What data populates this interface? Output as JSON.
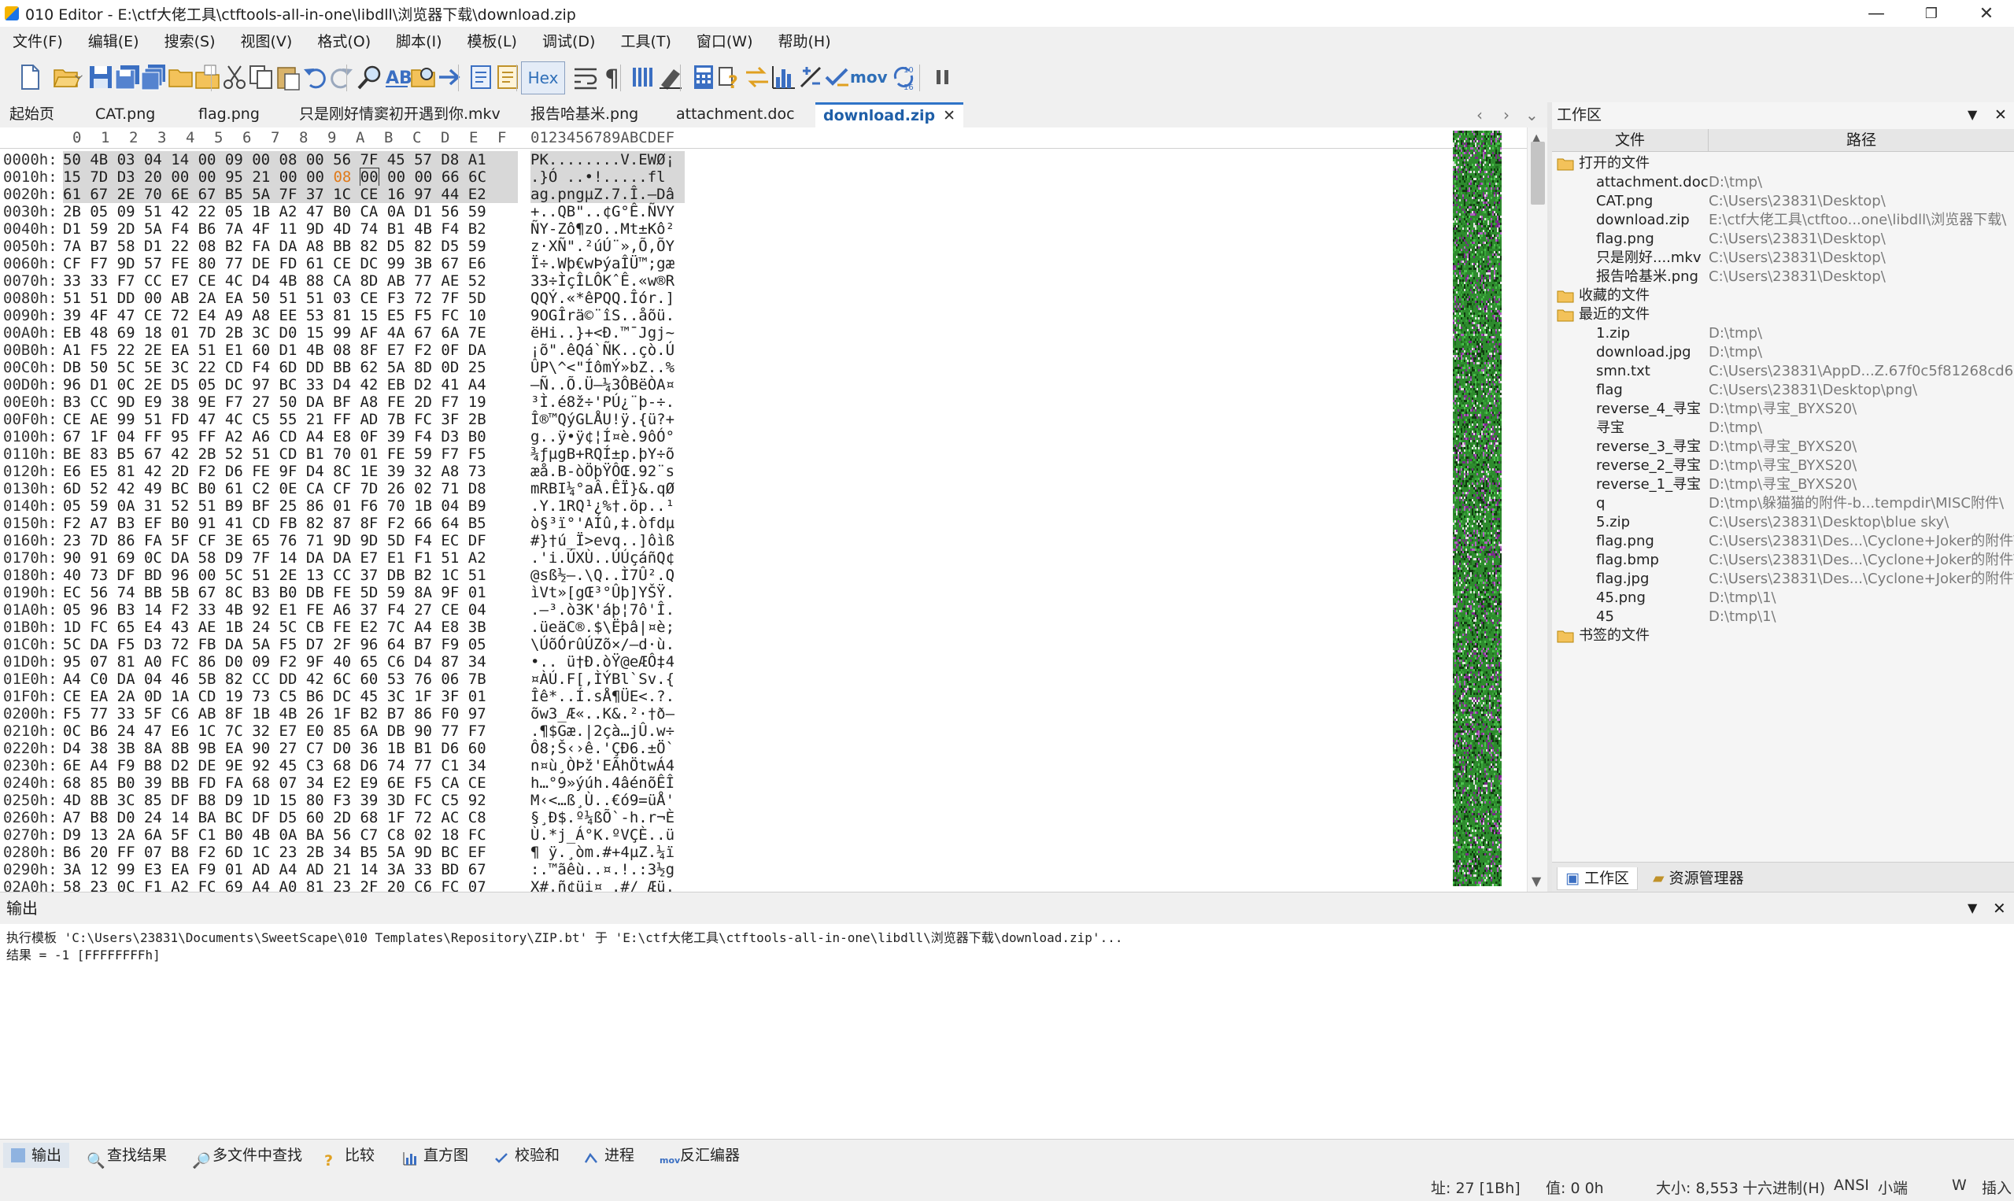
{
  "window": {
    "title": "010 Editor - E:\\ctf大佬工具\\ctftools-all-in-one\\libdll\\浏览器下载\\download.zip",
    "minimize": "—",
    "maximize": "❐",
    "close": "✕"
  },
  "menu": [
    "文件(F)",
    "编辑(E)",
    "搜索(S)",
    "视图(V)",
    "格式(O)",
    "脚本(I)",
    "模板(L)",
    "调试(D)",
    "工具(T)",
    "窗口(W)",
    "帮助(H)"
  ],
  "toolbar": {
    "hex_label": "Hex",
    "mov_label": "mov"
  },
  "tabs": [
    "起始页",
    "CAT.png",
    "flag.png",
    "只是刚好情窦初开遇到你.mkv",
    "报告哈基米.png",
    "attachment.doc",
    "download.zip"
  ],
  "tab_close": "✕",
  "hex": {
    "header_cols": [
      "0",
      "1",
      "2",
      "3",
      "4",
      "5",
      "6",
      "7",
      "8",
      "9",
      "A",
      "B",
      "C",
      "D",
      "E",
      "F"
    ],
    "header_chars": "0123456789ABCDEF",
    "rows": [
      [
        "0000h:",
        "50 4B 03 04 14 00 09 00 08 00 56 7F 45 57 D8 A1",
        "PK........V.EWØ¡"
      ],
      [
        "0010h:",
        "15 7D D3 20 00 00 95 21 00 00 08 00 00 00 66 6C",
        ".}Ó ..•!.....fl"
      ],
      [
        "0020h:",
        "61 67 2E 70 6E 67 B5 5A 7F 37 1C CE 16 97 44 E2",
        "ag.pngµZ.7.Î.—Dâ"
      ],
      [
        "0030h:",
        "2B 05 09 51 42 22 05 1B A2 47 B0 CA 0A D1 56 59",
        "+..QB\"..¢G°Ê.ÑVY"
      ],
      [
        "0040h:",
        "D1 59 2D 5A F4 B6 7A 4F 11 9D 4D 74 B1 4B F4 B2",
        "ÑY-Zô¶zO..Mt±Kô²"
      ],
      [
        "0050h:",
        "7A B7 58 D1 22 08 B2 FA DA A8 BB 82 D5 82 D5 59",
        "z·XÑ\".²úÚ¨»‚Õ‚ÕY"
      ],
      [
        "0060h:",
        "CF F7 9D 57 FE 80 77 DE FD 61 CE DC 99 3B 67 E6",
        "Ï÷.Wþ€wÞýaÎÜ™;gæ"
      ],
      [
        "0070h:",
        "33 33 F7 CC E7 CE 4C D4 4B 88 CA 8D AB 77 AE 52",
        "33÷ÌçÎLÔKˆÊ.«w®R"
      ],
      [
        "0080h:",
        "51 51 DD 00 AB 2A EA 50 51 51 03 CE F3 72 7F 5D",
        "QQÝ.«*êPQQ.Îór.]"
      ],
      [
        "0090h:",
        "39 4F 47 CE 72 E4 A9 A8 EE 53 81 15 E5 F5 FC 10",
        "9OGÎrä©¨îS..åõü."
      ],
      [
        "00A0h:",
        "EB 48 69 18 01 7D 2B 3C D0 15 99 AF 4A 67 6A 7E",
        "ëHi..}+<Ð.™¯Jgj~"
      ],
      [
        "00B0h:",
        "A1 F5 22 2E EA 51 E1 60 D1 4B 08 8F E7 F2 0F DA",
        "¡õ\".êQá`ÑK..çò.Ú"
      ],
      [
        "00C0h:",
        "DB 50 5C 5E 3C 22 CD F4 6D DD BB 62 5A 8D 0D 25",
        "ÛP\\^<\"ÍômÝ»bZ..%"
      ],
      [
        "00D0h:",
        "96 D1 0C 2E D5 05 DC 97 BC 33 D4 42 EB D2 41 A4",
        "–Ñ..Õ.Ü—¼3ÔBëÒA¤"
      ],
      [
        "00E0h:",
        "B3 CC 9D E9 38 9E F7 27 50 DA BF A8 FE 2D F7 19",
        "³Ì.é8ž÷'PÚ¿¨þ-÷."
      ],
      [
        "00F0h:",
        "CE AE 99 51 FD 47 4C C5 55 21 FF AD 7B FC 3F 2B",
        "Î®™QýGLÅU!ÿ.{ü?+"
      ],
      [
        "0100h:",
        "67 1F 04 FF 95 FF A2 A6 CD A4 E8 0F 39 F4 D3 B0",
        "g..ÿ•ÿ¢¦Í¤è.9ôÓ°"
      ],
      [
        "0110h:",
        "BE 83 B5 67 42 2B 52 51 CD B1 70 01 FE 59 F7 F5",
        "¾ƒµgB+RQÍ±p.þY÷õ"
      ],
      [
        "0120h:",
        "E6 E5 81 42 2D F2 D6 FE 9F D4 8C 1E 39 32 A8 73",
        "æå.B-òÖþŸÔŒ.92¨s"
      ],
      [
        "0130h:",
        "6D 52 42 49 BC B0 61 C2 0E CA CF 7D 26 02 71 D8",
        "mRBI¼°aÂ.ÊÏ}&.qØ"
      ],
      [
        "0140h:",
        "05 59 0A 31 52 51 B9 BF 25 86 01 F6 70 1B 04 B9",
        ".Y.1RQ¹¿%†.öp..¹"
      ],
      [
        "0150h:",
        "F2 A7 B3 EF B0 91 41 CD FB 82 87 8F F2 66 64 B5",
        "ò§³ï°'AÍû‚‡.òfdµ"
      ],
      [
        "0160h:",
        "23 7D 86 FA 5F CF 3E 65 76 71 9D 9D 5D F4 EC DF",
        "#}†ú_Ï>evq..]ôìß"
      ],
      [
        "0170h:",
        "90 91 69 0C DA 58 D9 7F 14 DA DA E7 E1 F1 51 A2",
        ".'i.ÚXÙ..ÚÚçáñQ¢"
      ],
      [
        "0180h:",
        "40 73 DF BD 96 00 5C 51 2E 13 CC 37 DB B2 1C 51",
        "@sß½–.\\Q..Ì7Û².Q"
      ],
      [
        "0190h:",
        "EC 56 74 BB 5B 67 8C B3 B0 DB FE 5D 59 8A 9F 01",
        "ìVt»[gŒ³°Ûþ]YŠŸ."
      ],
      [
        "01A0h:",
        "05 96 B3 14 F2 33 4B 92 E1 FE A6 37 F4 27 CE 04",
        ".–³.ò3K'áþ¦7ô'Î."
      ],
      [
        "01B0h:",
        "1D FC 65 E4 43 AE 1B 24 5C CB FE E2 7C A4 E8 3B",
        ".üeäC®.$\\Ëþâ|¤è;"
      ],
      [
        "01C0h:",
        "5C DA F5 D3 72 FB DA 5A F5 D7 2F 96 64 B7 F9 05",
        "\\ÚõÓrûÚZõ×/–d·ù."
      ],
      [
        "01D0h:",
        "95 07 81 A0 FC 86 D0 09 F2 9F 40 65 C6 D4 87 34",
        "•.. ü†Ð.òŸ@eÆÔ‡4"
      ],
      [
        "01E0h:",
        "A4 C0 DA 04 46 5B 82 CC DD 42 6C 60 53 76 06 7B",
        "¤ÀÚ.F[‚ÌÝBl`Sv.{"
      ],
      [
        "01F0h:",
        "CE EA 2A 0D 1A CD 19 73 C5 B6 DC 45 3C 1F 3F 01",
        "Îê*..Í.sÅ¶ÜE<.?."
      ],
      [
        "0200h:",
        "F5 77 33 5F C6 AB 8F 1B 4B 26 1F B2 B7 86 F0 97",
        "õw3_Æ«..K&.²·†ð—"
      ],
      [
        "0210h:",
        "0C B6 24 47 E6 1C 7C 32 E7 E0 85 6A DB 90 77 F7",
        ".¶$Gæ.|2çà…jÛ.w÷"
      ],
      [
        "0220h:",
        "D4 38 3B 8A 8B 9B EA 90 27 C7 D0 36 1B B1 D6 60",
        "Ô8;Š‹›ê.'ÇÐ6.±Ö`"
      ],
      [
        "0230h:",
        "6E A4 F9 B8 D2 DE 9E 92 45 C3 68 D6 74 77 C1 34",
        "n¤ù¸ÒÞž'EÃhÖtwÁ4"
      ],
      [
        "0240h:",
        "68 85 B0 39 BB FD FA 68 07 34 E2 E9 6E F5 CA CE",
        "h…°9»ýúh.4âénõÊÎ"
      ],
      [
        "0250h:",
        "4D 8B 3C 85 DF B8 D9 1D 15 80 F3 39 3D FC C5 92",
        "M‹<…ß¸Ù..€ó9=üÅ'"
      ],
      [
        "0260h:",
        "A7 B8 D0 24 14 BA BC DF D5 60 2D 68 1F 72 AC C8",
        "§¸Ð$.º¼ßÕ`-h.r¬È"
      ],
      [
        "0270h:",
        "D9 13 2A 6A 5F C1 B0 4B 0A BA 56 C7 C8 02 18 FC",
        "Ù.*j_Á°K.ºVÇÈ..ü"
      ],
      [
        "0280h:",
        "B6 20 FF 07 B8 F2 6D 1C 23 2B 34 B5 5A 9D BC EF",
        "¶ ÿ.¸òm.#+4µZ.¼ï"
      ],
      [
        "0290h:",
        "3A 12 99 E3 EA F9 01 AD A4 AD 21 14 3A 33 BD 67",
        ":.™ãêù..¤.!.:3½g"
      ],
      [
        "02A0h:",
        "58 23 0C F1 A2 FC 69 A4 A0 81 23 2F 20 C6 FC 07",
        "X#.ñ¢üi¤ .#/ Æü."
      ]
    ]
  },
  "workspace": {
    "title": "工作区",
    "col_file": "文件",
    "col_path": "路径",
    "groups": [
      {
        "name": "打开的文件",
        "items": [
          [
            "attachment.doc",
            "D:\\tmp\\"
          ],
          [
            "CAT.png",
            "C:\\Users\\23831\\Desktop\\"
          ],
          [
            "download.zip",
            "E:\\ctf大佬工具\\ctftoo...one\\libdll\\浏览器下载\\"
          ],
          [
            "flag.png",
            "C:\\Users\\23831\\Desktop\\"
          ],
          [
            "只是刚好....mkv",
            "C:\\Users\\23831\\Desktop\\"
          ],
          [
            "报告哈基米.png",
            "C:\\Users\\23831\\Desktop\\"
          ]
        ]
      },
      {
        "name": "收藏的文件",
        "items": []
      },
      {
        "name": "最近的文件",
        "items": [
          [
            "1.zip",
            "D:\\tmp\\"
          ],
          [
            "download.jpg",
            "D:\\tmp\\"
          ],
          [
            "smn.txt",
            "C:\\Users\\23831\\AppD...Z.67f0c5f81268cd6a\\"
          ],
          [
            "flag",
            "C:\\Users\\23831\\Desktop\\png\\"
          ],
          [
            "reverse_4_寻宝",
            "D:\\tmp\\寻宝_BYXS20\\"
          ],
          [
            "寻宝",
            "D:\\tmp\\"
          ],
          [
            "reverse_3_寻宝",
            "D:\\tmp\\寻宝_BYXS20\\"
          ],
          [
            "reverse_2_寻宝",
            "D:\\tmp\\寻宝_BYXS20\\"
          ],
          [
            "reverse_1_寻宝",
            "D:\\tmp\\寻宝_BYXS20\\"
          ],
          [
            "q",
            "D:\\tmp\\躲猫猫的附件-b...tempdir\\MISC附件\\"
          ],
          [
            "5.zip",
            "C:\\Users\\23831\\Desktop\\blue sky\\"
          ],
          [
            "flag.png",
            "C:\\Users\\23831\\Des...\\Cyclone+Joker的附件\\"
          ],
          [
            "flag.bmp",
            "C:\\Users\\23831\\Des...\\Cyclone+Joker的附件\\"
          ],
          [
            "flag.jpg",
            "C:\\Users\\23831\\Des...\\Cyclone+Joker的附件\\"
          ],
          [
            "45.png",
            "D:\\tmp\\1\\"
          ],
          [
            "45",
            "D:\\tmp\\1\\"
          ]
        ]
      },
      {
        "name": "书签的文件",
        "items": []
      }
    ],
    "tab_workspace": "工作区",
    "tab_explorer": "资源管理器"
  },
  "output": {
    "title": "输出",
    "line1": "执行模板 'C:\\Users\\23831\\Documents\\SweetScape\\010 Templates\\Repository\\ZIP.bt' 于 'E:\\ctf大佬工具\\ctftools-all-in-one\\libdll\\浏览器下载\\download.zip'...",
    "line2": "结果 = -1 [FFFFFFFFh]"
  },
  "bottom_tabs": [
    "输出",
    "查找结果",
    "多文件中查找",
    "比较",
    "直方图",
    "校验和",
    "进程",
    "反汇编器"
  ],
  "status": {
    "addr": "址: 27 [1Bh]",
    "value": "值: 0 0h",
    "size": "大小: 8,553",
    "mode": "十六进制(H)",
    "encoding": "ANSI",
    "endian": "小端",
    "w": "W",
    "insert": "插入"
  },
  "colors": {
    "accent": "#2f74c8",
    "cursor_byte": "#e07a1a",
    "selection": "#d8d8d8",
    "minimap_base": "#2e8b2e"
  }
}
